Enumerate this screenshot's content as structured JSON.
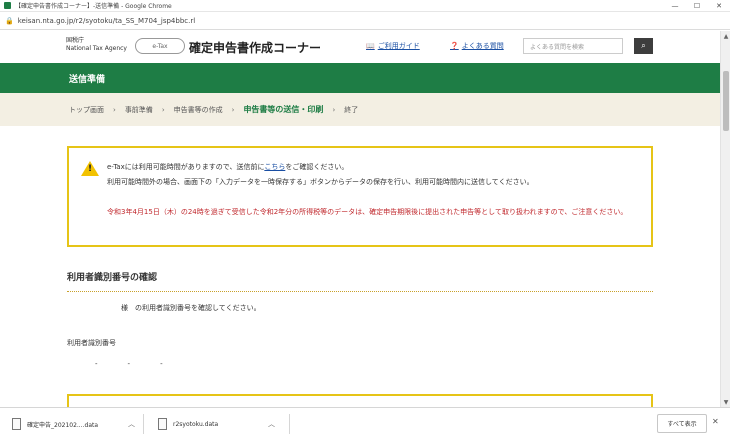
{
  "browser": {
    "window_title": "【確定申告書作成コーナー】-送信準備 - Google Chrome",
    "url": "keisan.nta.go.jp/r2/syotoku/ta_SS_M704_jsp4bbc.rl",
    "controls": {
      "minimize": "—",
      "maximize": "☐",
      "close": "✕"
    }
  },
  "header": {
    "org_line1": "国税庁",
    "org_line2": "National Tax Agency",
    "mascot": "e-Tax",
    "corner_title": "確定申告書作成コーナー",
    "usage_guide": "ご利用ガイド",
    "faq": "よくある質問",
    "search_placeholder": "よくある質問を検索"
  },
  "band": {
    "heading": "送信準備"
  },
  "steps": [
    {
      "label": "トップ画面"
    },
    {
      "label": "事前準備"
    },
    {
      "label": "申告書等の作成"
    },
    {
      "label": "申告書等の送信・印刷",
      "active": true
    },
    {
      "label": "終了"
    }
  ],
  "notice": {
    "line1_pre": "e-Taxには利用可能時間がありますので、送信前に",
    "line1_link": "こちら",
    "line1_post": "をご確認ください。",
    "line2": "利用可能時間外の場合、画面下の「入力データを一時保存する」ボタンからデータの保存を行い、利用可能時間内に送信してください。",
    "red": "令和3年4月15日（木）の24時を過ぎて受信した令和2年分の所得税等のデータは、確定申告期限後に提出された申告等として取り扱われますので、ご注意ください。"
  },
  "section": {
    "title": "利用者識別番号の確認",
    "body": "様　の利用者識別番号を確認してください。",
    "id_label": "利用者識別番号",
    "id_parts": [
      "-",
      "-",
      "-"
    ]
  },
  "downloads": {
    "items": [
      {
        "name": "確定申告_202102....data"
      },
      {
        "name": "r2syotoku.data"
      }
    ],
    "show_all": "すべて表示",
    "close": "✕"
  }
}
